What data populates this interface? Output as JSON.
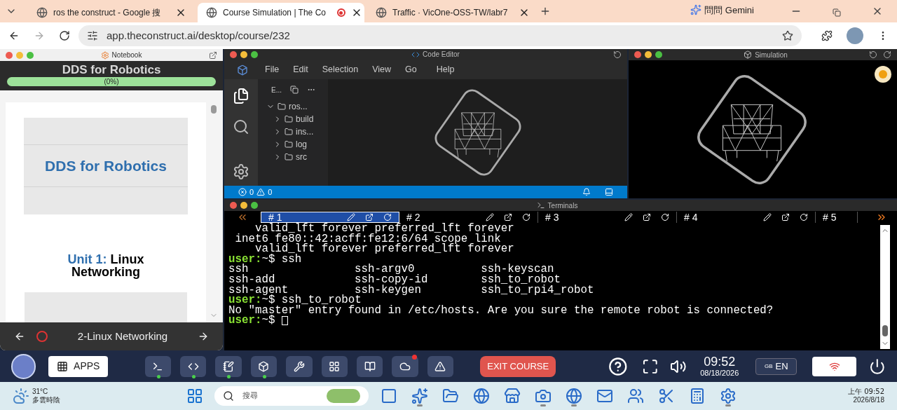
{
  "browser": {
    "tabs": [
      {
        "title": "ros the construct - Google 搜",
        "selected": false,
        "recording": false
      },
      {
        "title": "Course Simulation | The Co",
        "selected": true,
        "recording": true
      },
      {
        "title": "Traffic · VicOne-OSS-TW/labr7",
        "selected": false,
        "recording": false
      }
    ],
    "gemini": "問問 Gemini",
    "url": "app.theconstruct.ai/desktop/course/232"
  },
  "notebook": {
    "title": "Notebook",
    "course_title": "DDS for Robotics",
    "progress": {
      "label": "(0%)",
      "level": 0
    },
    "banner_title": "DDS for Robotics",
    "unit_label": "Unit 1:",
    "unit_name": "Linux Networking",
    "nav_label": "2-Linux Networking"
  },
  "editor": {
    "title": "Code Editor",
    "menu": [
      "File",
      "Edit",
      "Selection",
      "View",
      "Go",
      "Help"
    ],
    "explorer_header": "E...",
    "tree": [
      {
        "label": "ros...",
        "expanded": true,
        "children": [
          {
            "label": "build",
            "expanded": false
          },
          {
            "label": "ins...",
            "expanded": false
          },
          {
            "label": "log",
            "expanded": false
          },
          {
            "label": "src",
            "expanded": false
          }
        ]
      }
    ],
    "errors": "0",
    "warnings": "0"
  },
  "simulation": {
    "title": "Simulation"
  },
  "terminals": {
    "title": "Terminals",
    "tabs": [
      {
        "label": "# 1",
        "selected": true,
        "tools": true
      },
      {
        "label": "# 2",
        "selected": false,
        "tools": true
      },
      {
        "label": "# 3",
        "selected": false,
        "tools": true
      },
      {
        "label": "# 4",
        "selected": false,
        "tools": true
      },
      {
        "label": "# 5",
        "selected": false,
        "tools": false
      }
    ],
    "lines": [
      {
        "kind": "output",
        "text": "    valid_lft forever preferred_lft forever"
      },
      {
        "kind": "output",
        "text": " inet6 fe80::42:acff:fe12:6/64 scope link"
      },
      {
        "kind": "output",
        "text": "    valid_lft forever preferred_lft forever"
      },
      {
        "kind": "prompt",
        "user": "user:",
        "path": "~$",
        "command": "ssh",
        "cursor": false
      },
      {
        "kind": "output",
        "text": "ssh                ssh-argv0          ssh-keyscan"
      },
      {
        "kind": "output",
        "text": "ssh-add            ssh-copy-id        ssh_to_robot"
      },
      {
        "kind": "output",
        "text": "ssh-agent          ssh-keygen         ssh_to_rpi4_robot"
      },
      {
        "kind": "prompt",
        "user": "user:",
        "path": "~$",
        "command": "ssh_to_robot",
        "cursor": false
      },
      {
        "kind": "output",
        "text": "No \"master\" entry found in /etc/hosts. Are you sure the remote robot is connected?"
      },
      {
        "kind": "prompt",
        "user": "user:",
        "path": "~$",
        "cursor": true
      }
    ]
  },
  "dock": {
    "apps_label": "APPS",
    "apps": [
      {
        "running": true,
        "badge": false
      },
      {
        "running": true,
        "badge": false
      },
      {
        "running": true,
        "badge": false
      },
      {
        "running": true,
        "badge": false
      },
      {
        "running": false,
        "badge": false
      },
      {
        "running": false,
        "badge": false
      },
      {
        "running": false,
        "badge": false
      },
      {
        "running": false,
        "badge": true
      },
      {
        "running": false,
        "badge": false
      }
    ],
    "exit_label": "EXIT COURSE",
    "time": "09:52",
    "date": "08/18/2026",
    "lang_region": "GB",
    "lang": "EN"
  },
  "taskbar": {
    "temperature": "31°C",
    "weather": "多雲時陰",
    "search_placeholder": "搜尋",
    "apps": [
      {
        "running": false
      },
      {
        "running": true
      },
      {
        "running": false
      },
      {
        "running": false
      },
      {
        "running": false
      },
      {
        "running": true
      },
      {
        "running": true
      },
      {
        "running": false
      },
      {
        "running": false
      },
      {
        "running": false
      },
      {
        "running": false
      },
      {
        "running": true
      }
    ],
    "time": "上午 09:52",
    "date": "2026/8/18"
  }
}
